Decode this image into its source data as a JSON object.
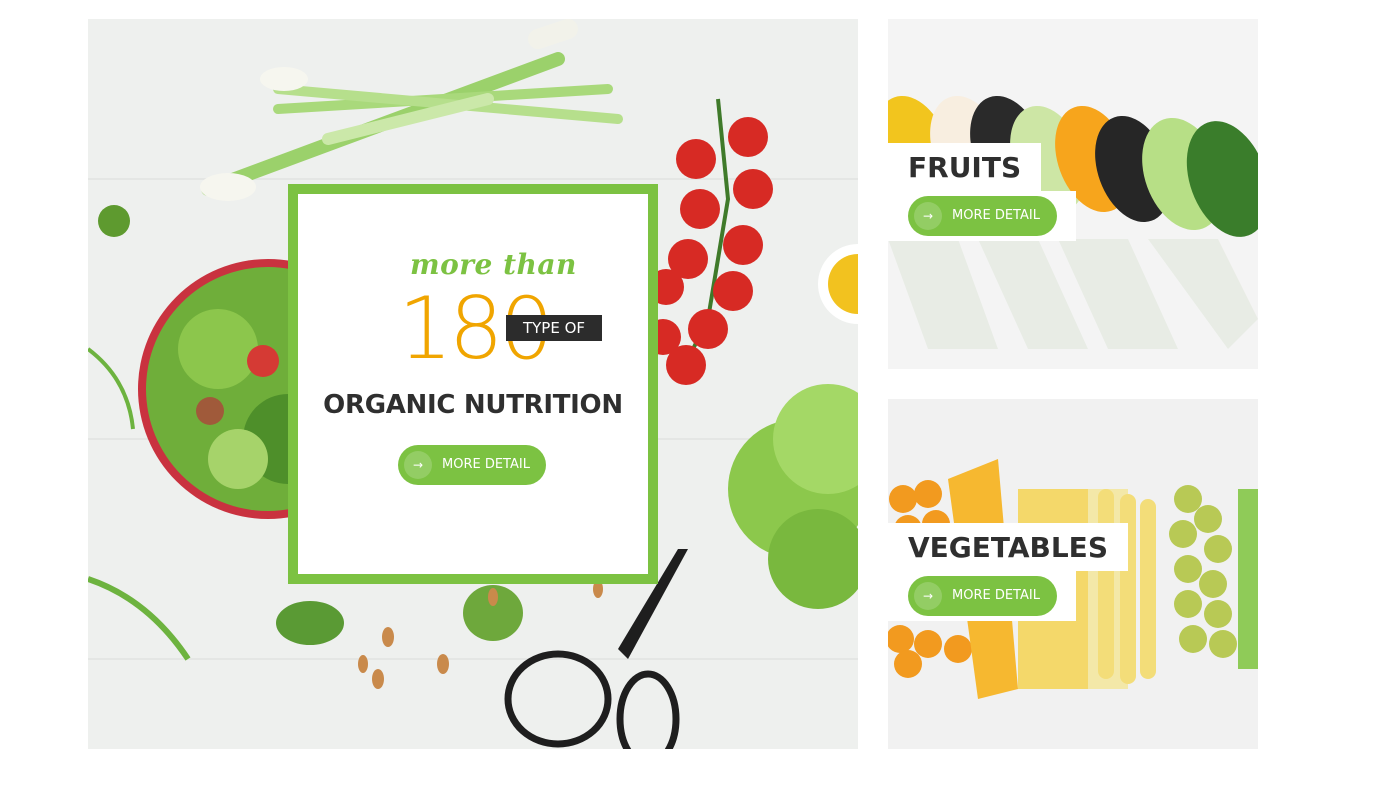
{
  "hero": {
    "eyebrow": "more than",
    "number": "180",
    "tag": "TYPE OF",
    "title": "ORGANIC NUTRITION",
    "button_label": "MORE DETAIL",
    "button_icon": "arrow-right-icon",
    "accent_color": "#7cc242",
    "number_color": "#f0a500"
  },
  "categories": [
    {
      "title": "FRUITS",
      "button_label": "MORE DETAIL",
      "button_icon": "arrow-right-icon"
    },
    {
      "title": "VEGETABLES",
      "button_label": "MORE DETAIL",
      "button_icon": "arrow-right-icon"
    }
  ]
}
